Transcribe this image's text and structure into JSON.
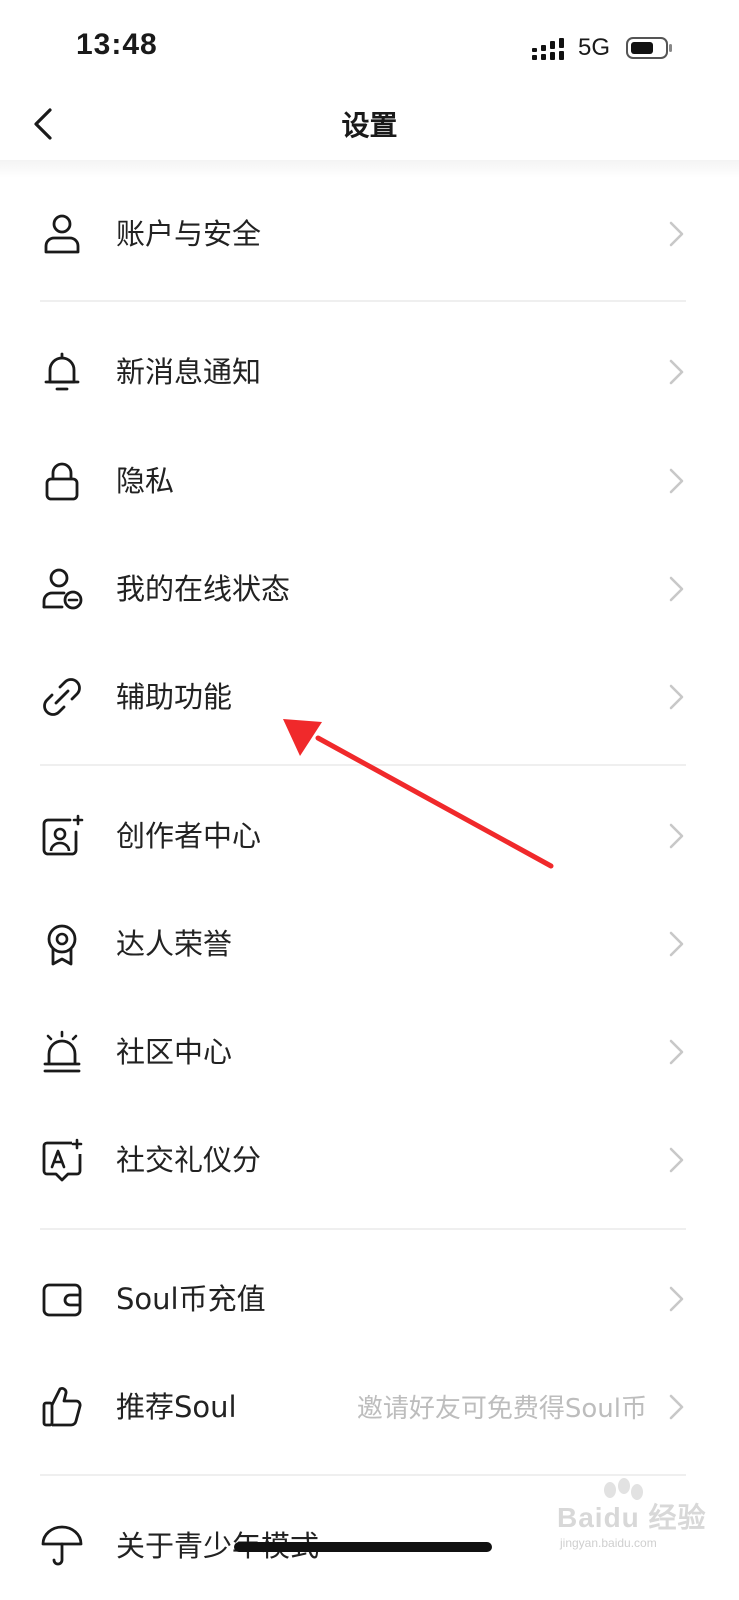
{
  "status_bar": {
    "time": "13:48",
    "network": "5G"
  },
  "header": {
    "title": "设置"
  },
  "rows": [
    {
      "label": "账户与安全",
      "icon": "user-icon"
    },
    {
      "label": "新消息通知",
      "icon": "bell-icon"
    },
    {
      "label": "隐私",
      "icon": "lock-icon"
    },
    {
      "label": "我的在线状态",
      "icon": "user-status-icon"
    },
    {
      "label": "辅助功能",
      "icon": "link-icon"
    },
    {
      "label": "创作者中心",
      "icon": "creator-icon"
    },
    {
      "label": "达人荣誉",
      "icon": "medal-icon"
    },
    {
      "label": "社区中心",
      "icon": "alarm-light-icon"
    },
    {
      "label": "社交礼仪分",
      "icon": "etiquette-icon"
    },
    {
      "label": "Soul币充值",
      "icon": "wallet-icon"
    },
    {
      "label": "推荐Soul",
      "hint": "邀请好友可免费得Soul币",
      "icon": "thumbs-up-icon"
    },
    {
      "label": "关于青少年模式",
      "icon": "umbrella-icon"
    }
  ],
  "watermark": {
    "brand": "Baidu 经验",
    "url": "jingyan.baidu.com"
  },
  "colors": {
    "annotation": "#f0292b",
    "chevron": "#c8c8c8",
    "divider": "#efefef"
  }
}
